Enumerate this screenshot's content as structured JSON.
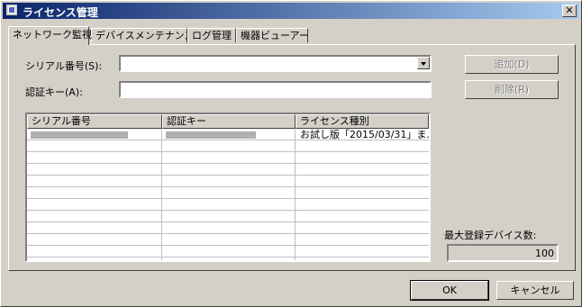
{
  "window": {
    "title": "ライセンス管理",
    "close_glyph": "✕"
  },
  "tabs": [
    {
      "label": "ネットワーク監視",
      "active": true
    },
    {
      "label": "デバイスメンテナンス",
      "active": false
    },
    {
      "label": "ログ管理",
      "active": false
    },
    {
      "label": "機器ビューアー",
      "active": false
    }
  ],
  "form": {
    "serial_label": "シリアル番号(S):",
    "serial_value": "",
    "auth_label": "認証キー(A):",
    "auth_value": ""
  },
  "buttons": {
    "add": "追加(D)",
    "delete": "削除(R)",
    "ok": "OK",
    "cancel": "キャンセル"
  },
  "table": {
    "columns": [
      "シリアル番号",
      "認証キー",
      "ライセンス種別"
    ],
    "rows": [
      {
        "serial": "",
        "auth": "",
        "license": "お試し版「2015/03/31」ま..."
      }
    ]
  },
  "max_devices": {
    "label": "最大登録デバイス数:",
    "value": "100"
  }
}
